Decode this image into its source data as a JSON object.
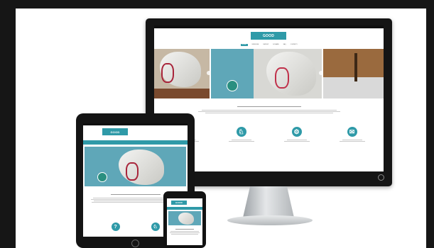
{
  "site": {
    "logo": "GOOD ",
    "nav": [
      "HOME",
      "MISSIONE",
      "SERVIZI",
      "DONARE",
      "FAQ",
      "CONTATTI"
    ],
    "features": [
      {
        "icon": "?"
      },
      {
        "icon": "♘"
      },
      {
        "icon": "⚙"
      },
      {
        "icon": "✉"
      }
    ]
  },
  "colors": {
    "accent": "#2f9aa8",
    "background": "#ffffff",
    "bezel": "#141414",
    "frame": "#1b1b1b"
  }
}
